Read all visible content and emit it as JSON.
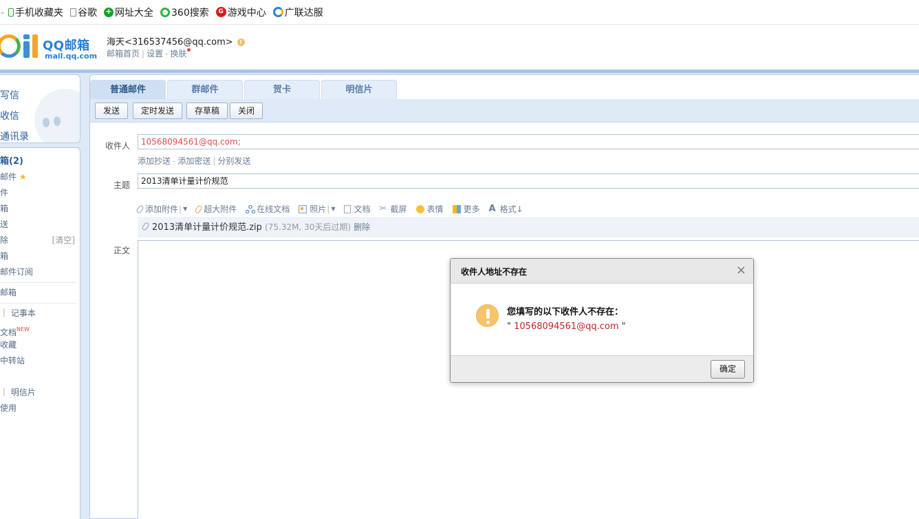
{
  "bookmarks": [
    {
      "icon": "mobile-icon",
      "label": "手机收藏夹"
    },
    {
      "icon": "page-icon",
      "label": "谷歌"
    },
    {
      "icon": "plus-globe-icon",
      "label": "网址大全"
    },
    {
      "icon": "360-icon",
      "label": "360搜索"
    },
    {
      "icon": "game-icon",
      "label": "游戏中心"
    },
    {
      "icon": "ie-icon",
      "label": "广联达服"
    }
  ],
  "header": {
    "logo_title": "QQ邮箱",
    "logo_subtitle": "mail.qq.com",
    "user": "海天<316537456@qq.com>",
    "links": [
      "邮箱首页",
      "设置",
      "换肤"
    ]
  },
  "sidebar": {
    "main_actions": [
      "写信",
      "收信",
      "通讯录"
    ],
    "folders": [
      {
        "label": "箱(2)",
        "extra": ""
      },
      {
        "label": "邮件",
        "extra": "star"
      },
      {
        "label": "件",
        "extra": ""
      },
      {
        "label": "箱",
        "extra": ""
      },
      {
        "label": "送",
        "extra": ""
      },
      {
        "label": "除",
        "extra": "[清空]"
      },
      {
        "label": "箱",
        "extra": ""
      },
      {
        "label": "邮件订阅",
        "extra": ""
      }
    ],
    "group_mailbox": "邮箱",
    "apps": [
      {
        "label": "｜ 记事本",
        "badge": ""
      },
      {
        "label": "文档",
        "badge": "NEW"
      },
      {
        "label": "收藏",
        "badge": ""
      },
      {
        "label": "中转站",
        "badge": ""
      }
    ],
    "extras": [
      "｜ 明信片",
      "使用"
    ]
  },
  "compose": {
    "tabs": [
      "普通邮件",
      "群邮件",
      "贺卡",
      "明信片"
    ],
    "toolbar": [
      "发送",
      "定时发送",
      "存草稿",
      "关闭"
    ],
    "to_label": "收件人",
    "to_value": "10568094561@qq.com;",
    "cc_links": [
      "添加抄送",
      "添加密送",
      "分别发送"
    ],
    "subject_label": "主题",
    "subject_value": "2013清单计量计价规范",
    "tools": [
      {
        "icon": "paperclip-icon",
        "label": "添加附件",
        "dropdown": true
      },
      {
        "icon": "large-attachment-icon",
        "label": "超大附件",
        "dropdown": false
      },
      {
        "icon": "online-doc-icon",
        "label": "在线文档",
        "dropdown": false
      },
      {
        "icon": "photo-icon",
        "label": "照片",
        "dropdown": true
      },
      {
        "icon": "document-icon",
        "label": "文档",
        "dropdown": false
      },
      {
        "icon": "screenshot-icon",
        "label": "截屏",
        "dropdown": false
      },
      {
        "icon": "emoji-icon",
        "label": "表情",
        "dropdown": false
      },
      {
        "icon": "more-icon",
        "label": "更多",
        "dropdown": false
      },
      {
        "icon": "format-icon",
        "label": "格式↓",
        "dropdown": false
      }
    ],
    "attachment": {
      "name": "2013清单计量计价规范.zip",
      "meta": "(75.32M, 30天后过期)",
      "delete_label": "删除"
    },
    "body_label": "正文"
  },
  "dialog": {
    "title": "收件人地址不存在",
    "message": "您填写的以下收件人不存在：",
    "quote_open": "\"",
    "address": "10568094561@qq.com",
    "quote_close": "\"",
    "ok_label": "确定"
  }
}
